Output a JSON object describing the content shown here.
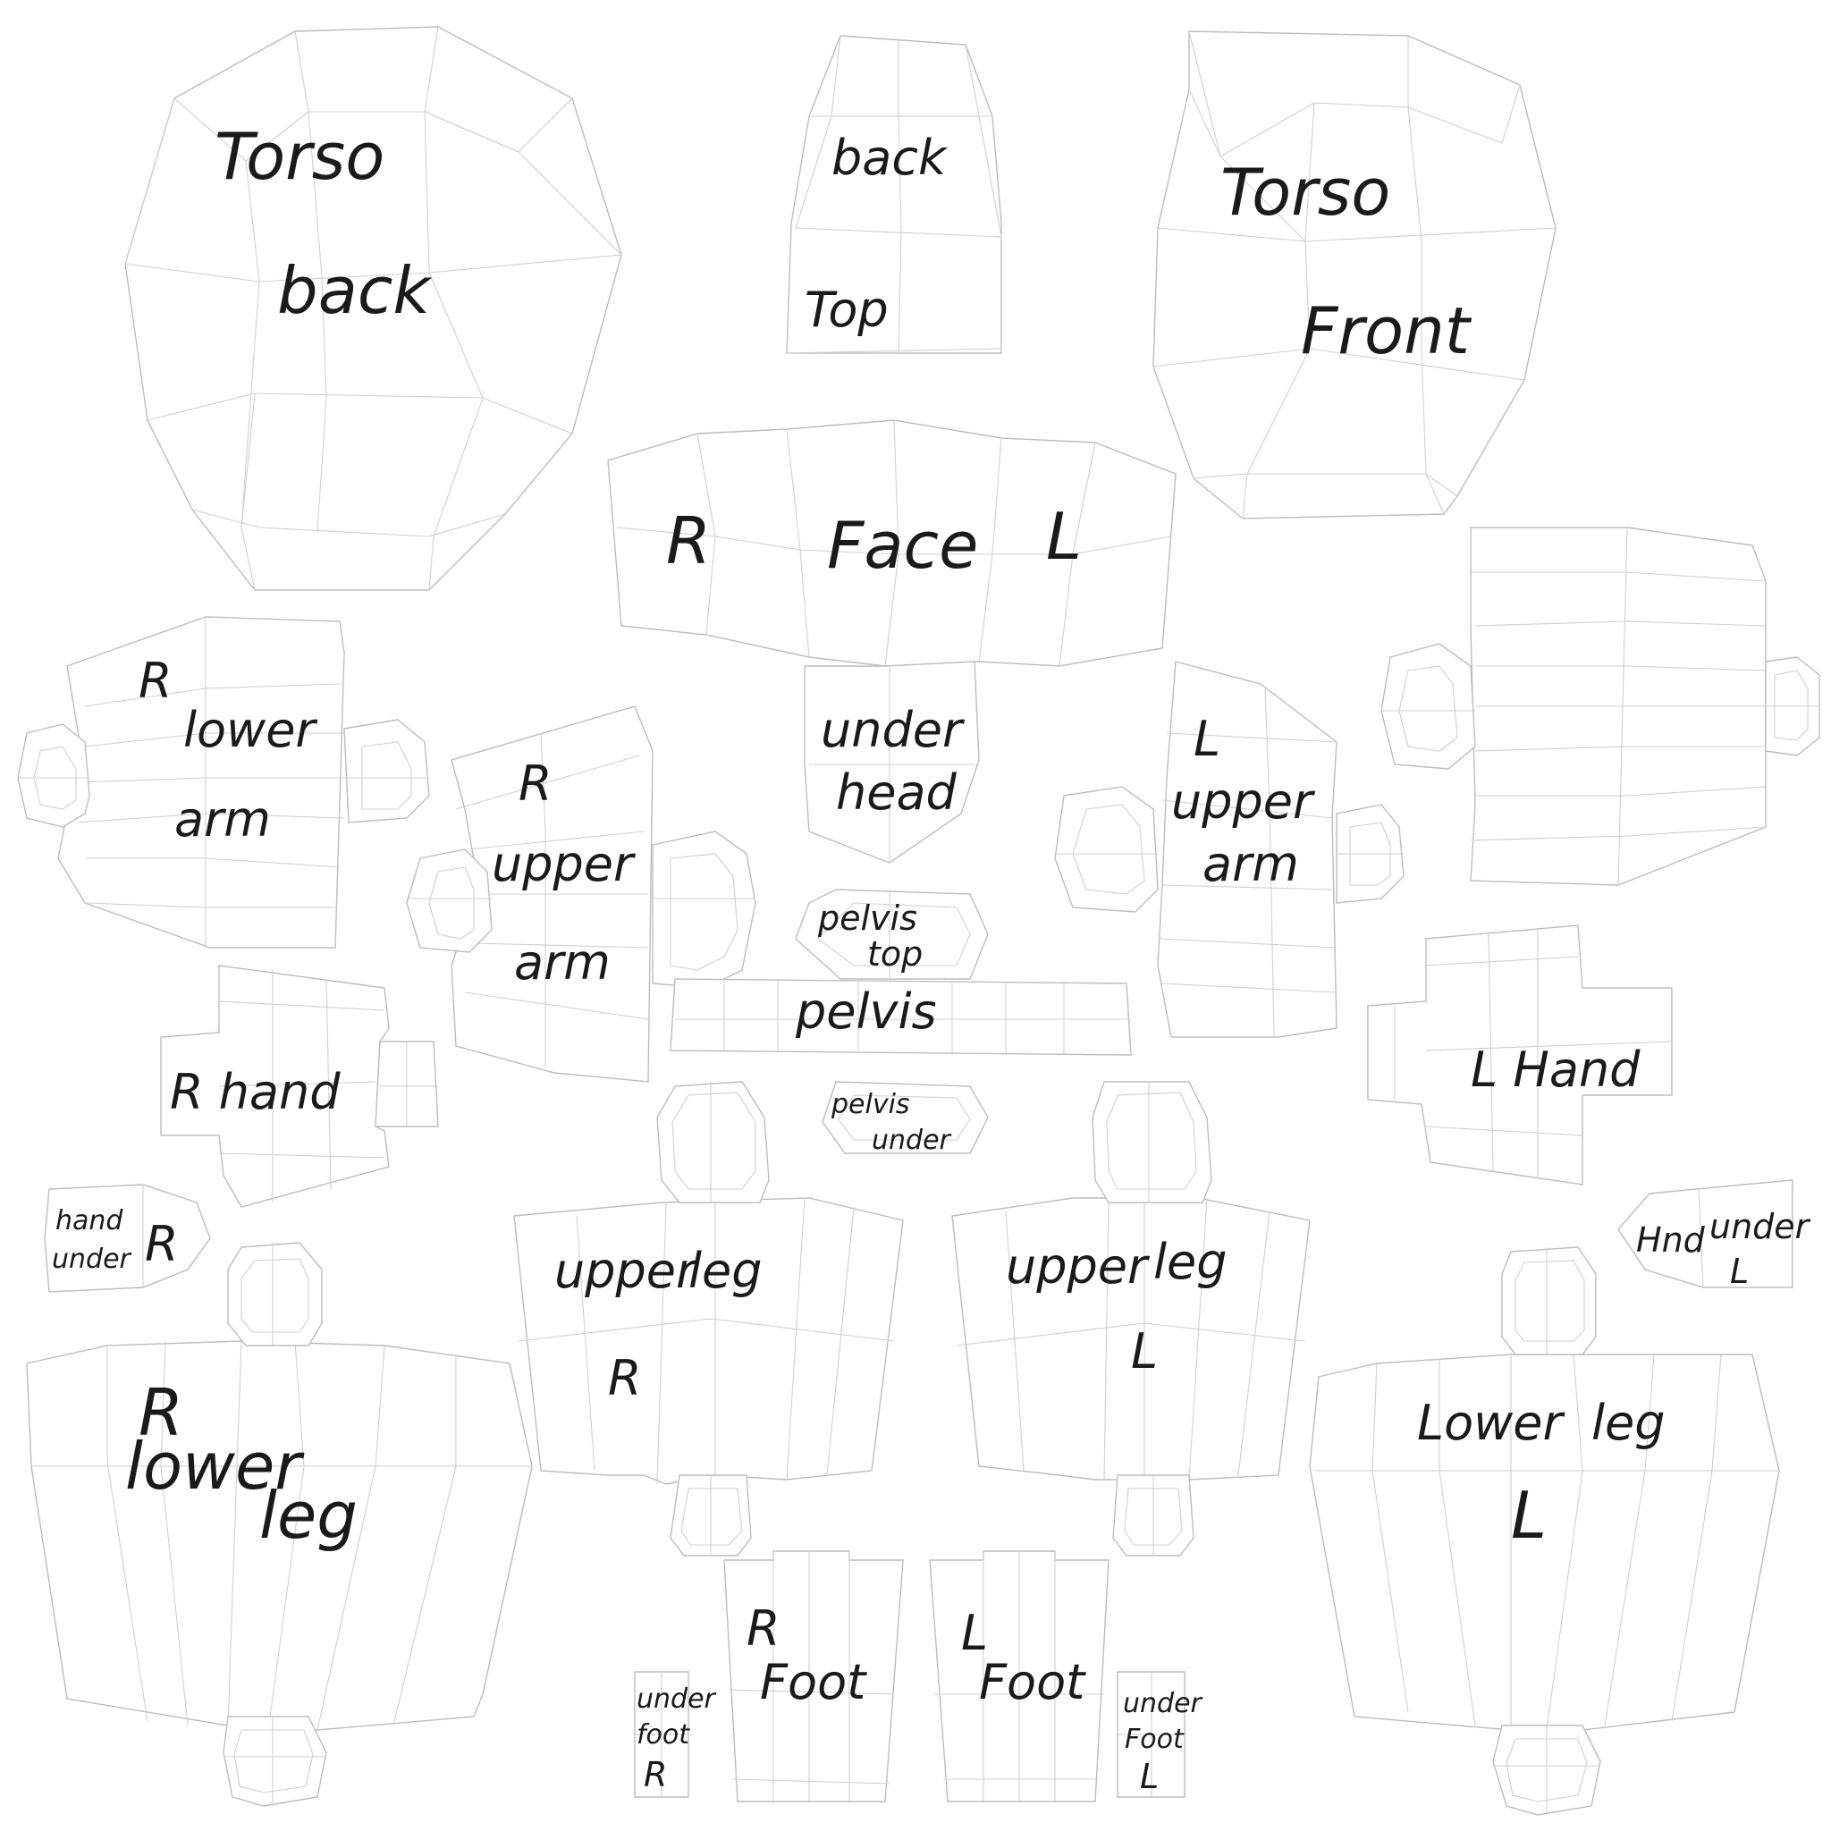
{
  "labels": {
    "torso_back": [
      "Torso",
      "back"
    ],
    "head_back_top": [
      "back",
      "Top"
    ],
    "face": [
      "R",
      "Face",
      "L"
    ],
    "torso_front": [
      "Torso",
      "Front"
    ],
    "r_lower_arm": [
      "R",
      "lower",
      "arm"
    ],
    "r_upper_arm": [
      "R",
      "upper",
      "arm"
    ],
    "under_head": [
      "under",
      "head"
    ],
    "l_upper_arm": [
      "L",
      "upper",
      "arm"
    ],
    "pelvis_top": [
      "pelvis",
      "top"
    ],
    "pelvis": "pelvis",
    "pelvis_under": [
      "pelvis",
      "under"
    ],
    "r_hand": "R hand",
    "l_hand": "L Hand",
    "hand_under_r": [
      "hand",
      "under",
      "R"
    ],
    "hand_under_l": [
      "Hnd",
      "under",
      "L"
    ],
    "r_upper_leg": [
      "upper",
      "leg",
      "R"
    ],
    "l_upper_leg": [
      "upper",
      "leg",
      "L"
    ],
    "r_lower_leg": [
      "R",
      "lower",
      "leg"
    ],
    "l_lower_leg": [
      "Lower",
      "leg",
      "L"
    ],
    "r_foot": [
      "R",
      "Foot"
    ],
    "l_foot": [
      "L",
      "Foot"
    ],
    "under_foot_r": [
      "under",
      "foot",
      "R"
    ],
    "under_foot_l": [
      "under",
      "Foot",
      "L"
    ]
  }
}
